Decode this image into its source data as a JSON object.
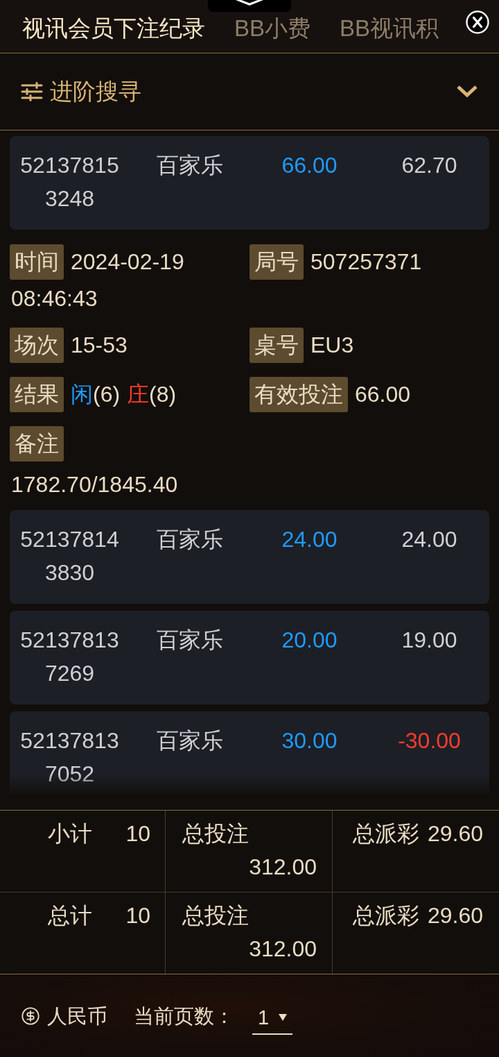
{
  "tabs": [
    {
      "label": "视讯会员下注纪录",
      "selected": true
    },
    {
      "label": "BB小费",
      "selected": false
    },
    {
      "label": "BB视讯积",
      "selected": false
    }
  ],
  "advanced_search": {
    "label": "进阶搜寻",
    "expanded": false
  },
  "records": [
    {
      "id": "521378153248",
      "game": "百家乐",
      "bet": "66.00",
      "payout": "62.70",
      "negative": false,
      "details": [
        {
          "kind": "datetime",
          "label": "时间",
          "date": "2024-02-19",
          "time": "08:46:43"
        },
        {
          "kind": "text",
          "label": "局号",
          "value": "507257371"
        },
        {
          "kind": "text",
          "label": "场次",
          "value": "15-53"
        },
        {
          "kind": "text",
          "label": "桌号",
          "value": "EU3"
        },
        {
          "kind": "result",
          "label": "结果",
          "parts": [
            {
              "side": "闲",
              "color": "#1e9bff",
              "score": "(6)"
            },
            {
              "side": "庄",
              "color": "#ff3b30",
              "score": "(8)"
            }
          ]
        },
        {
          "kind": "text",
          "label": "有效投注",
          "value": "66.00"
        },
        {
          "kind": "note",
          "label": "备注",
          "value": "1782.70/1845.40"
        }
      ]
    },
    {
      "id": "521378143830",
      "game": "百家乐",
      "bet": "24.00",
      "payout": "24.00",
      "negative": false
    },
    {
      "id": "521378137269",
      "game": "百家乐",
      "bet": "20.00",
      "payout": "19.00",
      "negative": false
    },
    {
      "id": "521378137052",
      "game": "百家乐",
      "bet": "30.00",
      "payout": "-30.00",
      "negative": true
    }
  ],
  "summary": [
    {
      "label": "小计",
      "count": "10",
      "bet_label": "总投注",
      "bet": "312.00",
      "payout_label": "总派彩",
      "payout": "29.60"
    },
    {
      "label": "总计",
      "count": "10",
      "bet_label": "总投注",
      "bet": "312.00",
      "payout_label": "总派彩",
      "payout": "29.60"
    }
  ],
  "footer": {
    "currency": "人民币",
    "page_label": "当前页数：",
    "page": "1"
  }
}
